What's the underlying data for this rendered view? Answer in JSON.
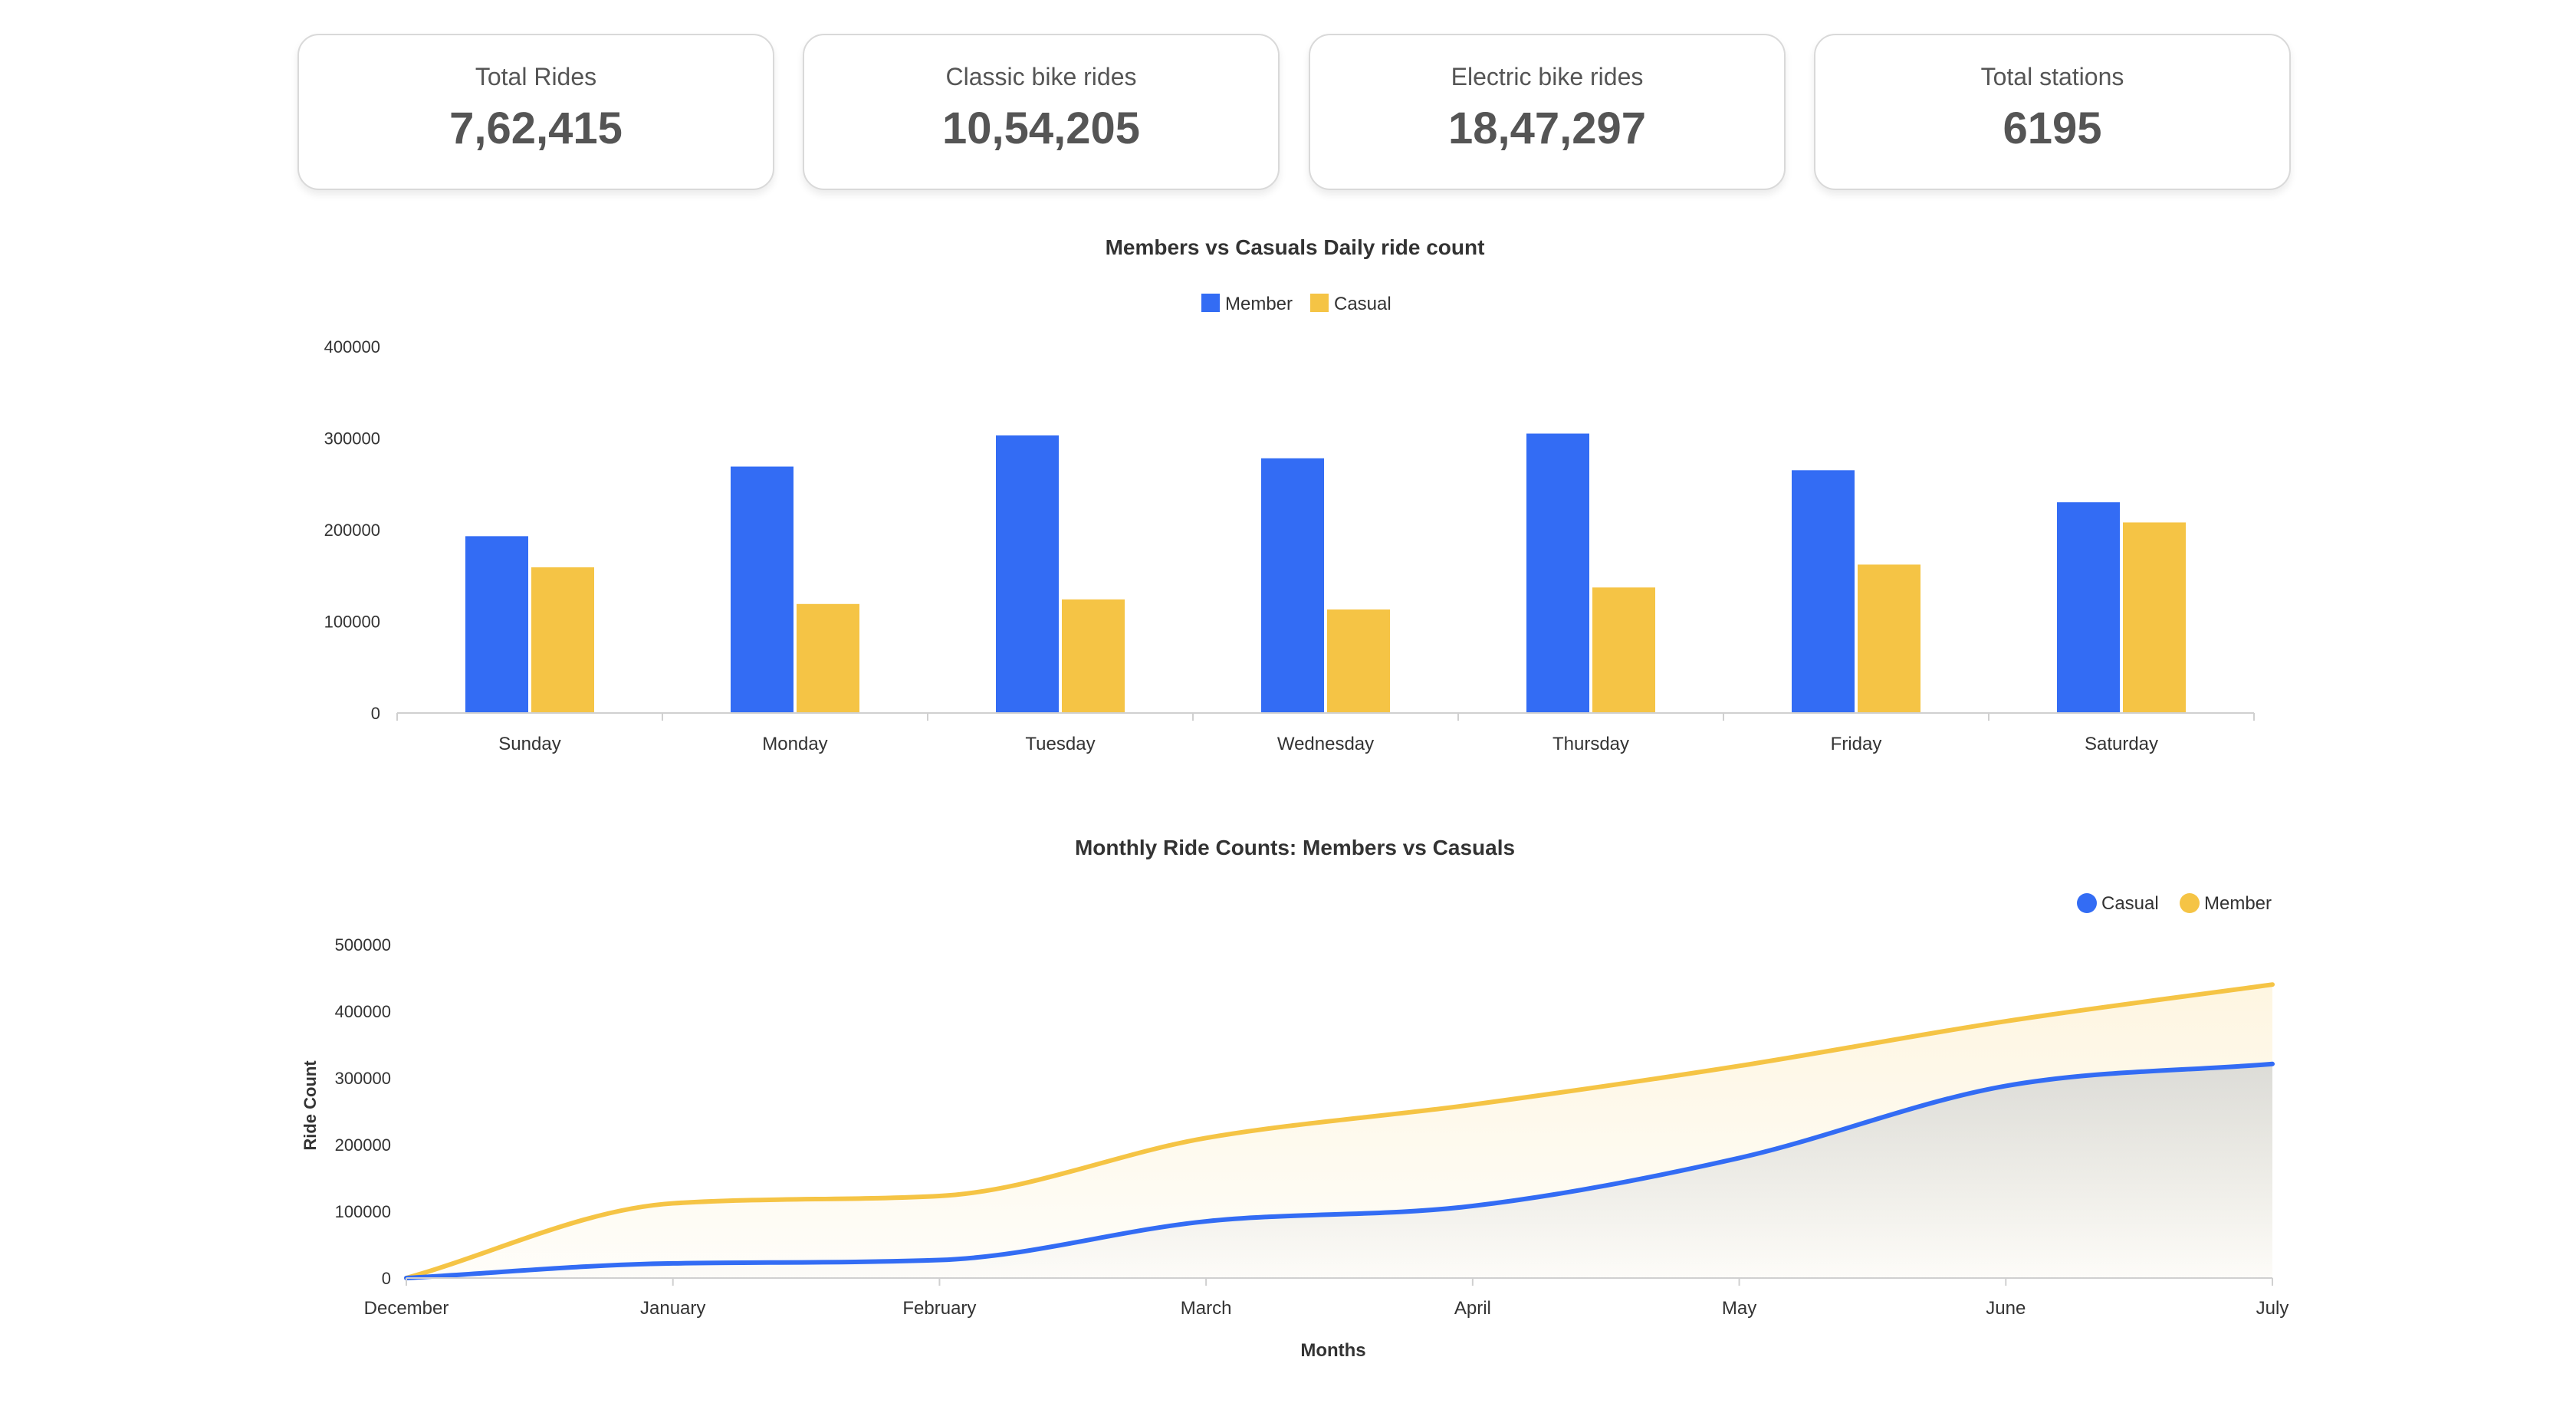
{
  "stats": [
    {
      "label": "Total Rides",
      "value": "7,62,415"
    },
    {
      "label": "Classic bike rides",
      "value": "10,54,205"
    },
    {
      "label": "Electric bike rides",
      "value": "18,47,297"
    },
    {
      "label": "Total stations",
      "value": "6195"
    }
  ],
  "colors": {
    "blue": "#336cf4",
    "yellow": "#f5c445"
  },
  "chart_data": [
    {
      "type": "bar",
      "title": "Members vs Casuals Daily ride count",
      "categories": [
        "Sunday",
        "Monday",
        "Tuesday",
        "Wednesday",
        "Thursday",
        "Friday",
        "Saturday"
      ],
      "series": [
        {
          "name": "Member",
          "color": "#336cf4",
          "values": [
            193000,
            269000,
            303000,
            278000,
            305000,
            265000,
            230000
          ]
        },
        {
          "name": "Casual",
          "color": "#f5c445",
          "values": [
            159000,
            119000,
            124000,
            113000,
            137000,
            162000,
            208000
          ]
        }
      ],
      "yticks": [
        "0",
        "100000",
        "200000",
        "300000",
        "400000"
      ],
      "ylim": [
        0,
        400000
      ],
      "legend": "top-center",
      "grid": false
    },
    {
      "type": "area",
      "title": "Monthly Ride Counts: Members vs Casuals",
      "xlabel": "Months",
      "ylabel": "Ride Count",
      "categories": [
        "December",
        "January",
        "February",
        "March",
        "April",
        "May",
        "June",
        "July"
      ],
      "series": [
        {
          "name": "Casual",
          "color": "#336cf4",
          "values": [
            0,
            22000,
            27000,
            85000,
            108000,
            180000,
            288000,
            321000
          ]
        },
        {
          "name": "Member",
          "color": "#f5c445",
          "values": [
            0,
            112000,
            123000,
            210000,
            260000,
            318000,
            385000,
            440000
          ]
        }
      ],
      "yticks": [
        "0",
        "100000",
        "200000",
        "300000",
        "400000",
        "500000"
      ],
      "ylim": [
        0,
        500000
      ],
      "legend": "top-right",
      "grid": false
    }
  ]
}
